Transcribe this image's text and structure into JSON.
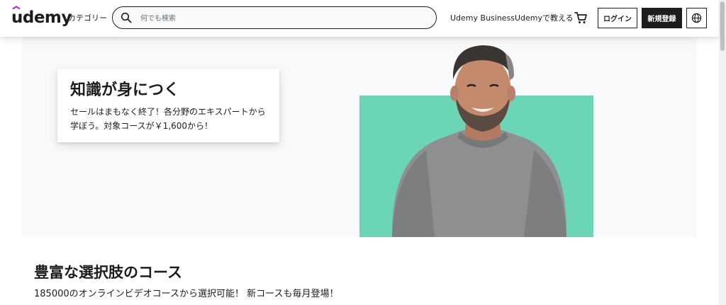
{
  "header": {
    "logo": "udemy",
    "categories": "カテゴリー",
    "search_placeholder": "何でも検索",
    "business": "Udemy Business",
    "teach": "Udemyで教える",
    "login": "ログイン",
    "signup": "新規登録"
  },
  "hero": {
    "title": "知識が身につく",
    "text": "セールはまもなく終了！各分野のエキスパートから学ぼう。対象コースが￥1,600から！"
  },
  "section": {
    "title": "豊富な選択肢のコース",
    "subtitle": "185000のオンラインビデオコースから選択可能！ 新コースも毎月登場！"
  },
  "colors": {
    "accent": "#a435f0",
    "dark": "#1c1d1f",
    "hero_bg": "#f7f9fa",
    "hero_green": "#6bd5b5"
  },
  "icons": [
    "udemy-hat-icon",
    "search-icon",
    "cart-icon",
    "globe-icon"
  ]
}
